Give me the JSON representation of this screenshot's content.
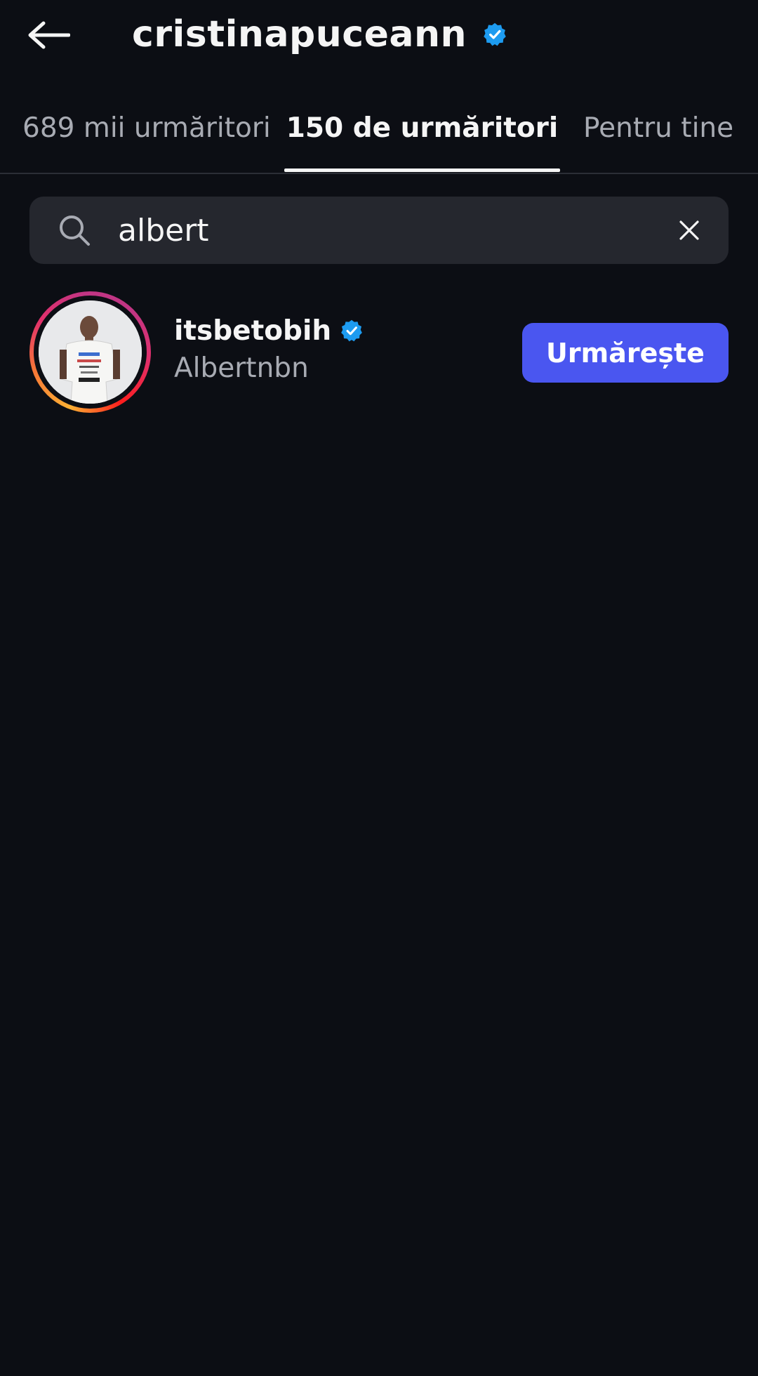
{
  "header": {
    "title": "cristinapuceann",
    "back_icon": "arrow-left-icon",
    "verified_icon": "verified-badge-icon"
  },
  "tabs": [
    {
      "label": "689 mii urmăritori",
      "active": false
    },
    {
      "label": "150 de urmăritori",
      "active": true
    },
    {
      "label": "Pentru tine",
      "active": false
    }
  ],
  "search": {
    "value": "albert",
    "icon": "search-icon",
    "clear_icon": "close-icon"
  },
  "results": [
    {
      "username": "itsbetobih",
      "full_name": "Albertnbn",
      "verified": true,
      "follow_label": "Urmărește"
    }
  ],
  "colors": {
    "background": "#0c0e14",
    "search_bg": "#25272e",
    "accent": "#4a56f0",
    "verified": "#1d9bf0",
    "muted_text": "#a8abb3"
  }
}
